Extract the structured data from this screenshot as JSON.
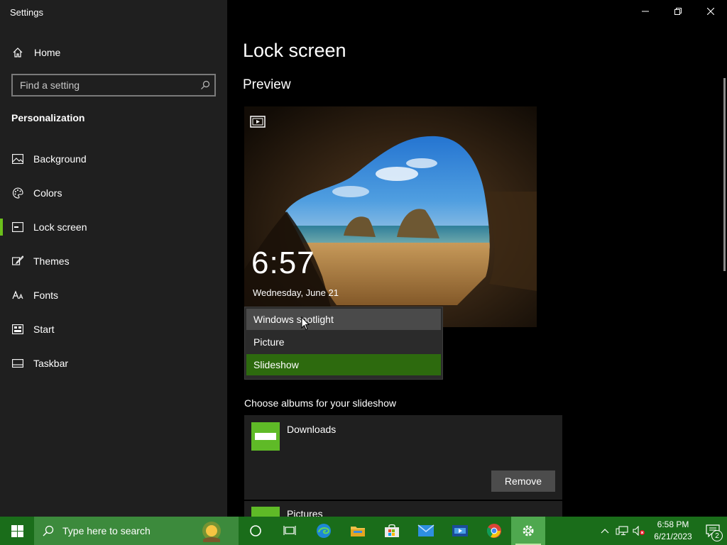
{
  "window": {
    "title": "Settings"
  },
  "sidebar": {
    "home_label": "Home",
    "search_placeholder": "Find a setting",
    "section_title": "Personalization",
    "items": [
      {
        "label": "Background",
        "icon": "image-icon",
        "active": false
      },
      {
        "label": "Colors",
        "icon": "palette-icon",
        "active": false
      },
      {
        "label": "Lock screen",
        "icon": "lock-screen-icon",
        "active": true
      },
      {
        "label": "Themes",
        "icon": "brush-icon",
        "active": false
      },
      {
        "label": "Fonts",
        "icon": "font-icon",
        "active": false
      },
      {
        "label": "Start",
        "icon": "start-icon",
        "active": false
      },
      {
        "label": "Taskbar",
        "icon": "taskbar-icon",
        "active": false
      }
    ]
  },
  "main": {
    "page_title": "Lock screen",
    "preview_title": "Preview",
    "preview": {
      "time": "6:57",
      "date": "Wednesday, June 21"
    },
    "background_dropdown": {
      "options": [
        "Windows spotlight",
        "Picture",
        "Slideshow"
      ],
      "hovered": "Windows spotlight",
      "selected": "Slideshow"
    },
    "albums_label": "Choose albums for your slideshow",
    "albums": [
      {
        "name": "Downloads",
        "button": "Remove"
      },
      {
        "name": "Pictures"
      }
    ]
  },
  "taskbar": {
    "search_placeholder": "Type here to search",
    "apps": [
      "cortana-icon",
      "task-view-icon",
      "edge-icon",
      "file-explorer-icon",
      "store-icon",
      "mail-icon",
      "movies-icon",
      "chrome-icon",
      "settings-icon"
    ],
    "time": "6:58 PM",
    "date": "6/21/2023",
    "notification_count": "2"
  },
  "colors": {
    "accent": "#6bbf1b",
    "taskbar": "#1a6d1a",
    "selected_option": "#2d6a0e"
  }
}
